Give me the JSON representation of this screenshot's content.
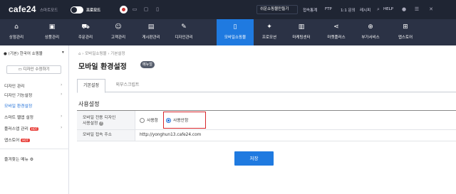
{
  "topbar": {
    "logo": "cafe24",
    "smart_mode": "스마트모드",
    "pro_mode": "프로모드",
    "shop_button": "쉬운쇼핑몰만들기",
    "links": [
      "접속통계",
      "FTP",
      "1:1 문의",
      "레시피",
      "HELP"
    ]
  },
  "nav": {
    "items": [
      {
        "label": "상점관리",
        "icon": "house-icon"
      },
      {
        "label": "상품관리",
        "icon": "box-icon"
      },
      {
        "label": "주문관리",
        "icon": "cart-icon"
      },
      {
        "label": "고객관리",
        "icon": "person-icon"
      },
      {
        "label": "게시판관리",
        "icon": "board-icon"
      },
      {
        "label": "디자인관리",
        "icon": "palette-icon"
      },
      {
        "label": "모바일쇼핑몰",
        "icon": "mobile-icon"
      },
      {
        "label": "프로모션",
        "icon": "star-icon"
      },
      {
        "label": "마케팅센터",
        "icon": "chart-icon"
      },
      {
        "label": "마켓플러스",
        "icon": "share-icon"
      },
      {
        "label": "부가서비스",
        "icon": "plus-icon"
      },
      {
        "label": "앱스토어",
        "icon": "grid-icon"
      }
    ],
    "active_index": 6,
    "active_color": "#1f7ae0"
  },
  "sidebar": {
    "mall_select": "(기본) 한국어 쇼핑몰",
    "design_button": "디자인 수정하기",
    "items": [
      {
        "label": "디자인 관리"
      },
      {
        "label": "디자인 기능설정"
      },
      {
        "label": "모바일 환경설정"
      },
      {
        "label": "스마트 웹앱 설정"
      },
      {
        "label": "플러스앱 관리",
        "badge": "HOT"
      },
      {
        "label": "앱스토어",
        "badge": "HOT"
      }
    ],
    "favorites": "즐겨찾는 메뉴"
  },
  "content": {
    "breadcrumb": [
      "모바일쇼핑몰",
      "기본설정"
    ],
    "title": "모바일 환경설정",
    "title_badge": "메뉴얼",
    "tabs": [
      "기본설정",
      "외부스크립트"
    ],
    "section": "사용설정",
    "rows": [
      {
        "label_line1": "모바일 전용 디자인",
        "label_line2": "사용설정",
        "options": [
          {
            "label": "사용함",
            "checked": false
          },
          {
            "label": "사용안함",
            "checked": true
          }
        ]
      },
      {
        "label": "모바일 접속 주소",
        "value": "http://yonghun13.cafe24.com"
      }
    ],
    "save": "저장",
    "highlight_color": "#d8262c"
  }
}
